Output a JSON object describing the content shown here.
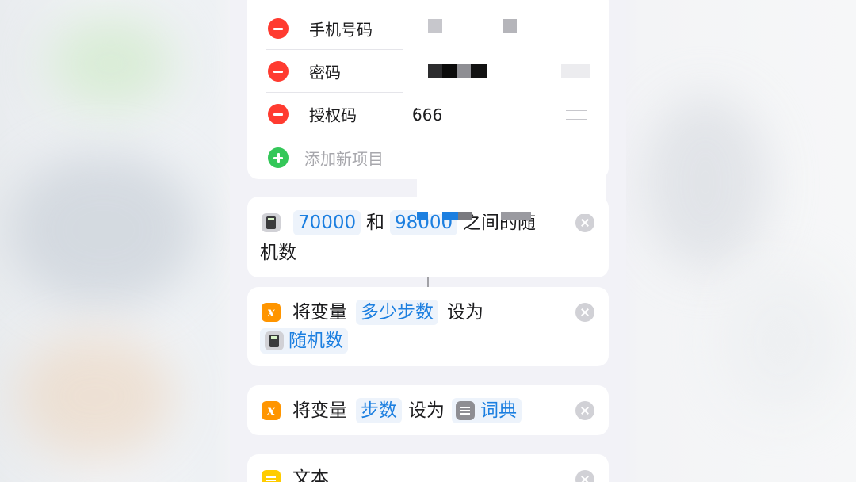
{
  "dictionary": {
    "rows": [
      {
        "key": "手机号码",
        "value": ""
      },
      {
        "key": "密码",
        "value": ""
      },
      {
        "key": "授权码",
        "value": "666"
      }
    ],
    "add_label": "添加新项目"
  },
  "random_action": {
    "min": "70000",
    "mid": "和",
    "max": "98000",
    "tail": "之间的随",
    "wrap": "机数",
    "icon": "calculator-icon"
  },
  "set_var_1": {
    "prefix": "将变量",
    "var_name": "多少步数",
    "verb": "设为",
    "value": "随机数",
    "icon": "variable-icon"
  },
  "set_var_2": {
    "prefix": "将变量",
    "var_name": "步数",
    "verb": "设为",
    "value": "词典",
    "icon": "variable-icon"
  },
  "text_action": {
    "title": "文本",
    "icon": "text-icon"
  },
  "colors": {
    "token_blue": "#1c7fe0",
    "remove_red": "#ff3b30",
    "add_green": "#34c759",
    "variable_orange": "#ff9500",
    "text_yellow": "#ffcc00"
  }
}
